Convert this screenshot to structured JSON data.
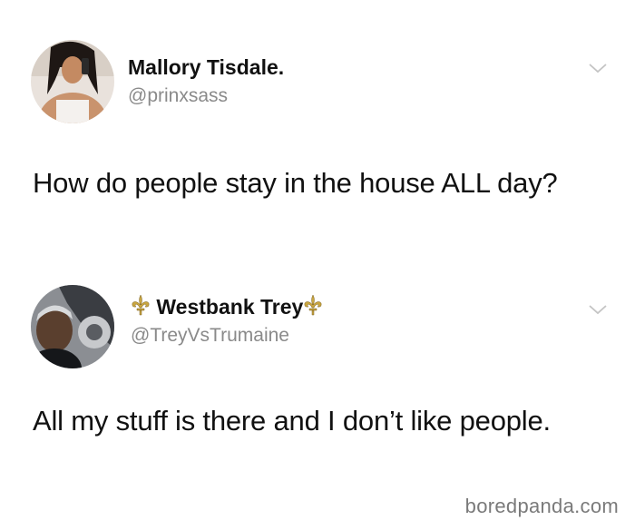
{
  "tweets": [
    {
      "display_name": "Mallory Tisdale.",
      "handle": "@prinxsass",
      "text": "How do people stay in the house ALL day?",
      "avatar_icon": "profile-photo",
      "menu_icon": "chevron-down-icon"
    },
    {
      "display_name": "Westbank Trey",
      "name_decoration_icon": "fleur-de-lis-icon",
      "handle": "@TreyVsTrumaine",
      "text": "All my stuff is there and I don’t like people.",
      "avatar_icon": "profile-photo",
      "menu_icon": "chevron-down-icon"
    }
  ],
  "watermark": "boredpanda.com",
  "colors": {
    "text": "#111111",
    "handle": "#8a8a8a",
    "fleur": "#c9a640",
    "background": "#ffffff"
  }
}
